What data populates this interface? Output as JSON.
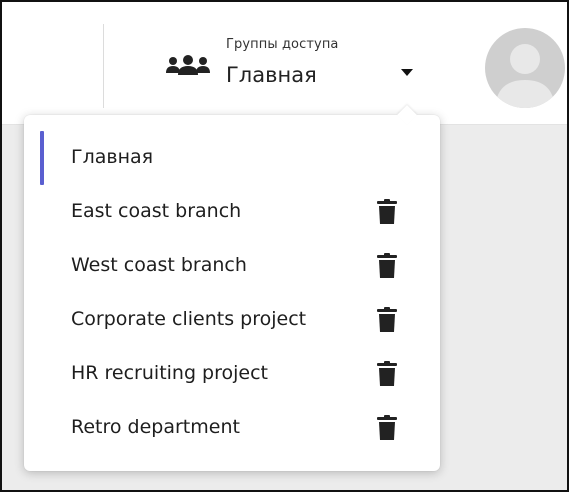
{
  "header": {
    "groups_caption": "Группы доступа",
    "current_group": "Главная"
  },
  "icons": {
    "groups": "people-group-icon",
    "caret": "caret-down-icon",
    "avatar": "user-avatar-icon",
    "delete": "trash-icon"
  },
  "colors": {
    "active_indicator": "#5a5fd0",
    "trash_icon": "#222222",
    "avatar_bg": "#cfcfcf"
  },
  "dropdown": {
    "items": [
      {
        "label": "Главная",
        "active": true,
        "deletable": false
      },
      {
        "label": "East coast branch",
        "active": false,
        "deletable": true
      },
      {
        "label": "West coast branch",
        "active": false,
        "deletable": true
      },
      {
        "label": "Corporate clients project",
        "active": false,
        "deletable": true
      },
      {
        "label": "HR recruiting project",
        "active": false,
        "deletable": true
      },
      {
        "label": "Retro department",
        "active": false,
        "deletable": true
      }
    ]
  }
}
